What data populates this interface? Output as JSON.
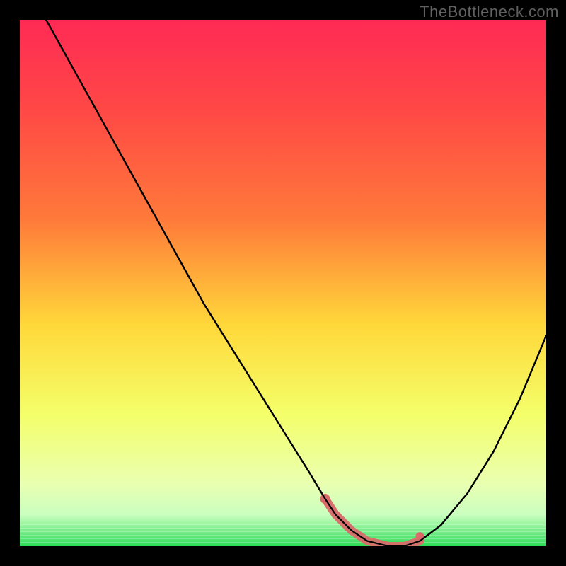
{
  "watermark": "TheBottleneck.com",
  "colors": {
    "bg": "#000000",
    "curve": "#000000",
    "highlight": "#d96a6a",
    "gradient_top": "#ff2a55",
    "gradient_mid1": "#ff7a3a",
    "gradient_mid2": "#ffd83a",
    "gradient_mid3": "#f4ff6a",
    "gradient_bottom_fade": "#caffc0",
    "gradient_bottom": "#2bdc57"
  },
  "chart_data": {
    "type": "line",
    "title": "",
    "xlabel": "",
    "ylabel": "",
    "xlim": [
      0,
      100
    ],
    "ylim": [
      0,
      100
    ],
    "series": [
      {
        "name": "bottleneck-curve",
        "x": [
          5,
          10,
          15,
          20,
          25,
          30,
          35,
          40,
          45,
          50,
          55,
          58,
          60,
          63,
          66,
          70,
          73,
          76,
          80,
          85,
          90,
          95,
          100
        ],
        "y": [
          100,
          91,
          82,
          73,
          64,
          55,
          46,
          38,
          30,
          22,
          14,
          9,
          6,
          3,
          1,
          0,
          0,
          1,
          4,
          10,
          18,
          28,
          40
        ]
      }
    ],
    "annotations": [
      {
        "name": "highlight-start",
        "x": 58,
        "y": 9
      },
      {
        "name": "highlight-end",
        "x": 76,
        "y": 2
      }
    ]
  }
}
